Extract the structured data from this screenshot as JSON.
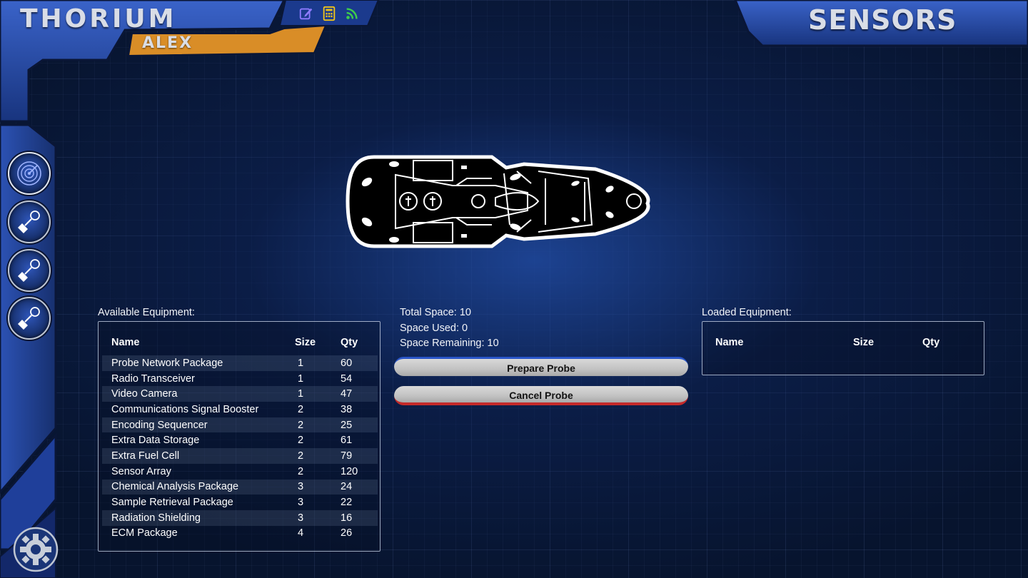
{
  "app": {
    "title": "THORIUM",
    "user": "ALEX",
    "station": "SENSORS"
  },
  "top_icons": [
    {
      "name": "edit-icon",
      "color": "#8f7bff"
    },
    {
      "name": "calculator-icon",
      "color": "#f0c419"
    },
    {
      "name": "rss-icon",
      "color": "#3ecf4a"
    }
  ],
  "sidebar": {
    "cards": [
      {
        "icon": "radar-icon"
      },
      {
        "icon": "probe-icon"
      },
      {
        "icon": "probe-icon"
      },
      {
        "icon": "probe-icon"
      }
    ],
    "settings_icon": "gear-icon"
  },
  "colors": {
    "frame_blue": "#1f3f9a",
    "accent_orange": "#d98d27",
    "prepare_accent": "#2a56c9",
    "cancel_accent": "#c42a2a"
  },
  "available": {
    "label": "Available Equipment:",
    "headers": {
      "name": "Name",
      "size": "Size",
      "qty": "Qty"
    },
    "rows": [
      {
        "name": "Probe Network Package",
        "size": "1",
        "qty": "60"
      },
      {
        "name": "Radio Transceiver",
        "size": "1",
        "qty": "54"
      },
      {
        "name": "Video Camera",
        "size": "1",
        "qty": "47"
      },
      {
        "name": "Communications Signal Booster",
        "size": "2",
        "qty": "38"
      },
      {
        "name": "Encoding Sequencer",
        "size": "2",
        "qty": "25"
      },
      {
        "name": "Extra Data Storage",
        "size": "2",
        "qty": "61"
      },
      {
        "name": "Extra Fuel Cell",
        "size": "2",
        "qty": "79"
      },
      {
        "name": "Sensor Array",
        "size": "2",
        "qty": "120"
      },
      {
        "name": "Chemical Analysis Package",
        "size": "3",
        "qty": "24"
      },
      {
        "name": "Sample Retrieval Package",
        "size": "3",
        "qty": "22"
      },
      {
        "name": "Radiation Shielding",
        "size": "3",
        "qty": "16"
      },
      {
        "name": "ECM Package",
        "size": "4",
        "qty": "26"
      }
    ]
  },
  "space": {
    "total": "Total Space: 10",
    "used": "Space Used: 0",
    "remaining": "Space Remaining: 10"
  },
  "buttons": {
    "prepare": "Prepare Probe",
    "cancel": "Cancel Probe"
  },
  "loaded": {
    "label": "Loaded Equipment:",
    "headers": {
      "name": "Name",
      "size": "Size",
      "qty": "Qty"
    },
    "rows": []
  }
}
